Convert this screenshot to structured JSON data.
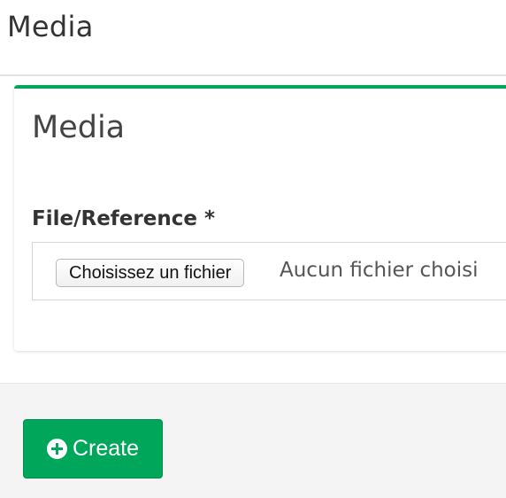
{
  "header": {
    "title": "Media"
  },
  "box": {
    "title": "Media",
    "accent_color": "#00a65a",
    "file_field": {
      "label": "File/Reference *",
      "button_label": "Choisissez un fichier",
      "status_text": "Aucun fichier choisi"
    }
  },
  "footer": {
    "create_button": {
      "label": "Create",
      "icon": "plus-circle-icon",
      "color": "#00a65a"
    }
  }
}
